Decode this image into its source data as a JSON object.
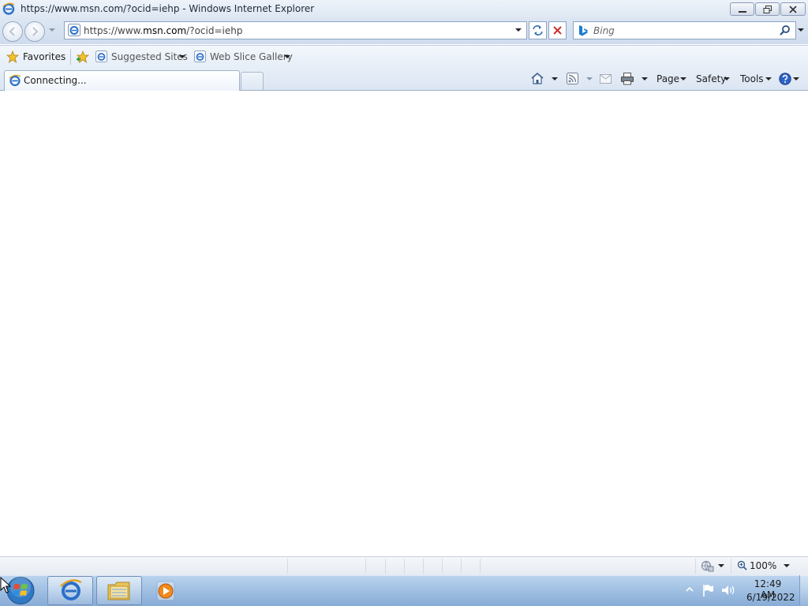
{
  "window": {
    "title": "https://www.msn.com/?ocid=iehp - Windows Internet Explorer"
  },
  "address": {
    "prefix": "https://www.",
    "domain": "msn.com",
    "suffix": "/?ocid=iehp"
  },
  "search": {
    "placeholder": "Bing"
  },
  "favorites_bar": {
    "favorites_label": "Favorites",
    "suggested_sites_label": "Suggested Sites",
    "web_slice_gallery_label": "Web Slice Gallery"
  },
  "tabs": [
    {
      "label": "Connecting...",
      "active": true
    }
  ],
  "command_bar": {
    "page_label": "Page",
    "safety_label": "Safety",
    "tools_label": "Tools"
  },
  "status_bar": {
    "zoom": "100%"
  },
  "taskbar": {
    "pinned": [
      "internet-explorer",
      "windows-explorer",
      "media-player"
    ],
    "clock_time": "12:49 AM",
    "clock_date": "6/19/2022"
  },
  "colors": {
    "chrome_blue": "#dce6f3",
    "taskbar_blue": "#9fbfe2",
    "stop_red": "#d03030",
    "ie_blue": "#2a6fc9"
  }
}
